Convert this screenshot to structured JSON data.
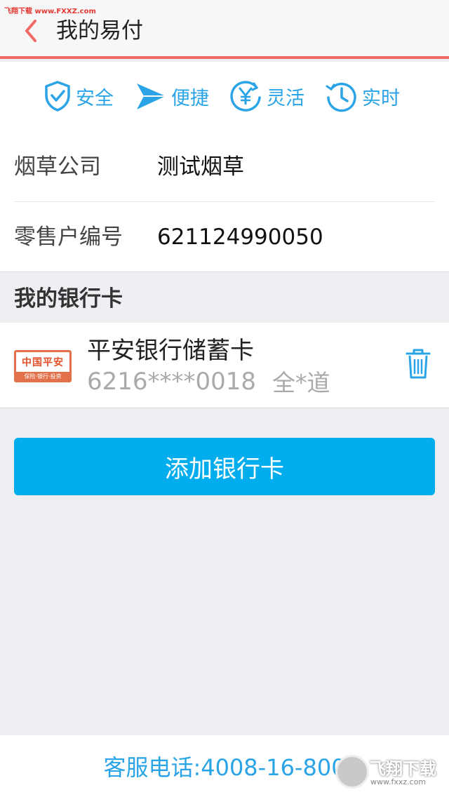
{
  "watermark_top": "飞翔下载 www.FXXZ.com",
  "header": {
    "title": "我的易付"
  },
  "features": [
    {
      "label": "安全",
      "icon": "shield-check-icon"
    },
    {
      "label": "便捷",
      "icon": "paper-plane-icon"
    },
    {
      "label": "灵活",
      "icon": "yen-circle-icon"
    },
    {
      "label": "实时",
      "icon": "clock-icon"
    }
  ],
  "info": {
    "company_label": "烟草公司",
    "company_value": "测试烟草",
    "retailer_label": "零售户编号",
    "retailer_value": "621124990050"
  },
  "section_title": "我的银行卡",
  "card": {
    "logo_text": "中国平安",
    "logo_sub": "保险·银行·投资",
    "bank_name": "平安银行储蓄卡",
    "card_number": "6216****0018",
    "holder": "全*道"
  },
  "add_button_label": "添加银行卡",
  "footer": {
    "phone_text": "客服电话:4008-16-800"
  },
  "watermark_bottom": {
    "main": "飞翔下载",
    "url": "www.fxxz.com"
  },
  "colors": {
    "accent_blue": "#02adee",
    "header_line": "#f06a63",
    "feature_blue": "#2aa4e6"
  }
}
